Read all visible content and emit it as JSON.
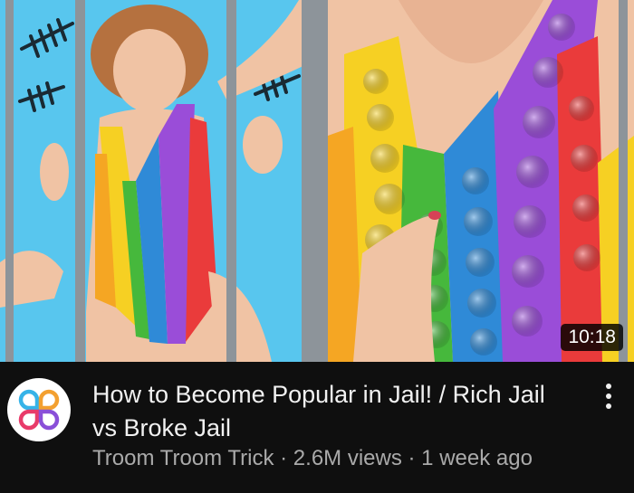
{
  "video": {
    "title": "How to Become Popular in Jail! / Rich Jail vs Broke Jail",
    "duration": "10:18",
    "channel": "Troom Troom Trick",
    "views": "2.6M views",
    "age": "1 week ago",
    "separator": " · "
  },
  "icons": {
    "avatar": "channel-logo-icon",
    "menu": "more-vert-icon"
  },
  "colors": {
    "background": "#0f0f0f",
    "title": "#f1f1f1",
    "meta": "#aaaaaa",
    "jail_wall": "#58c6ee",
    "bars": "#8d949a"
  }
}
